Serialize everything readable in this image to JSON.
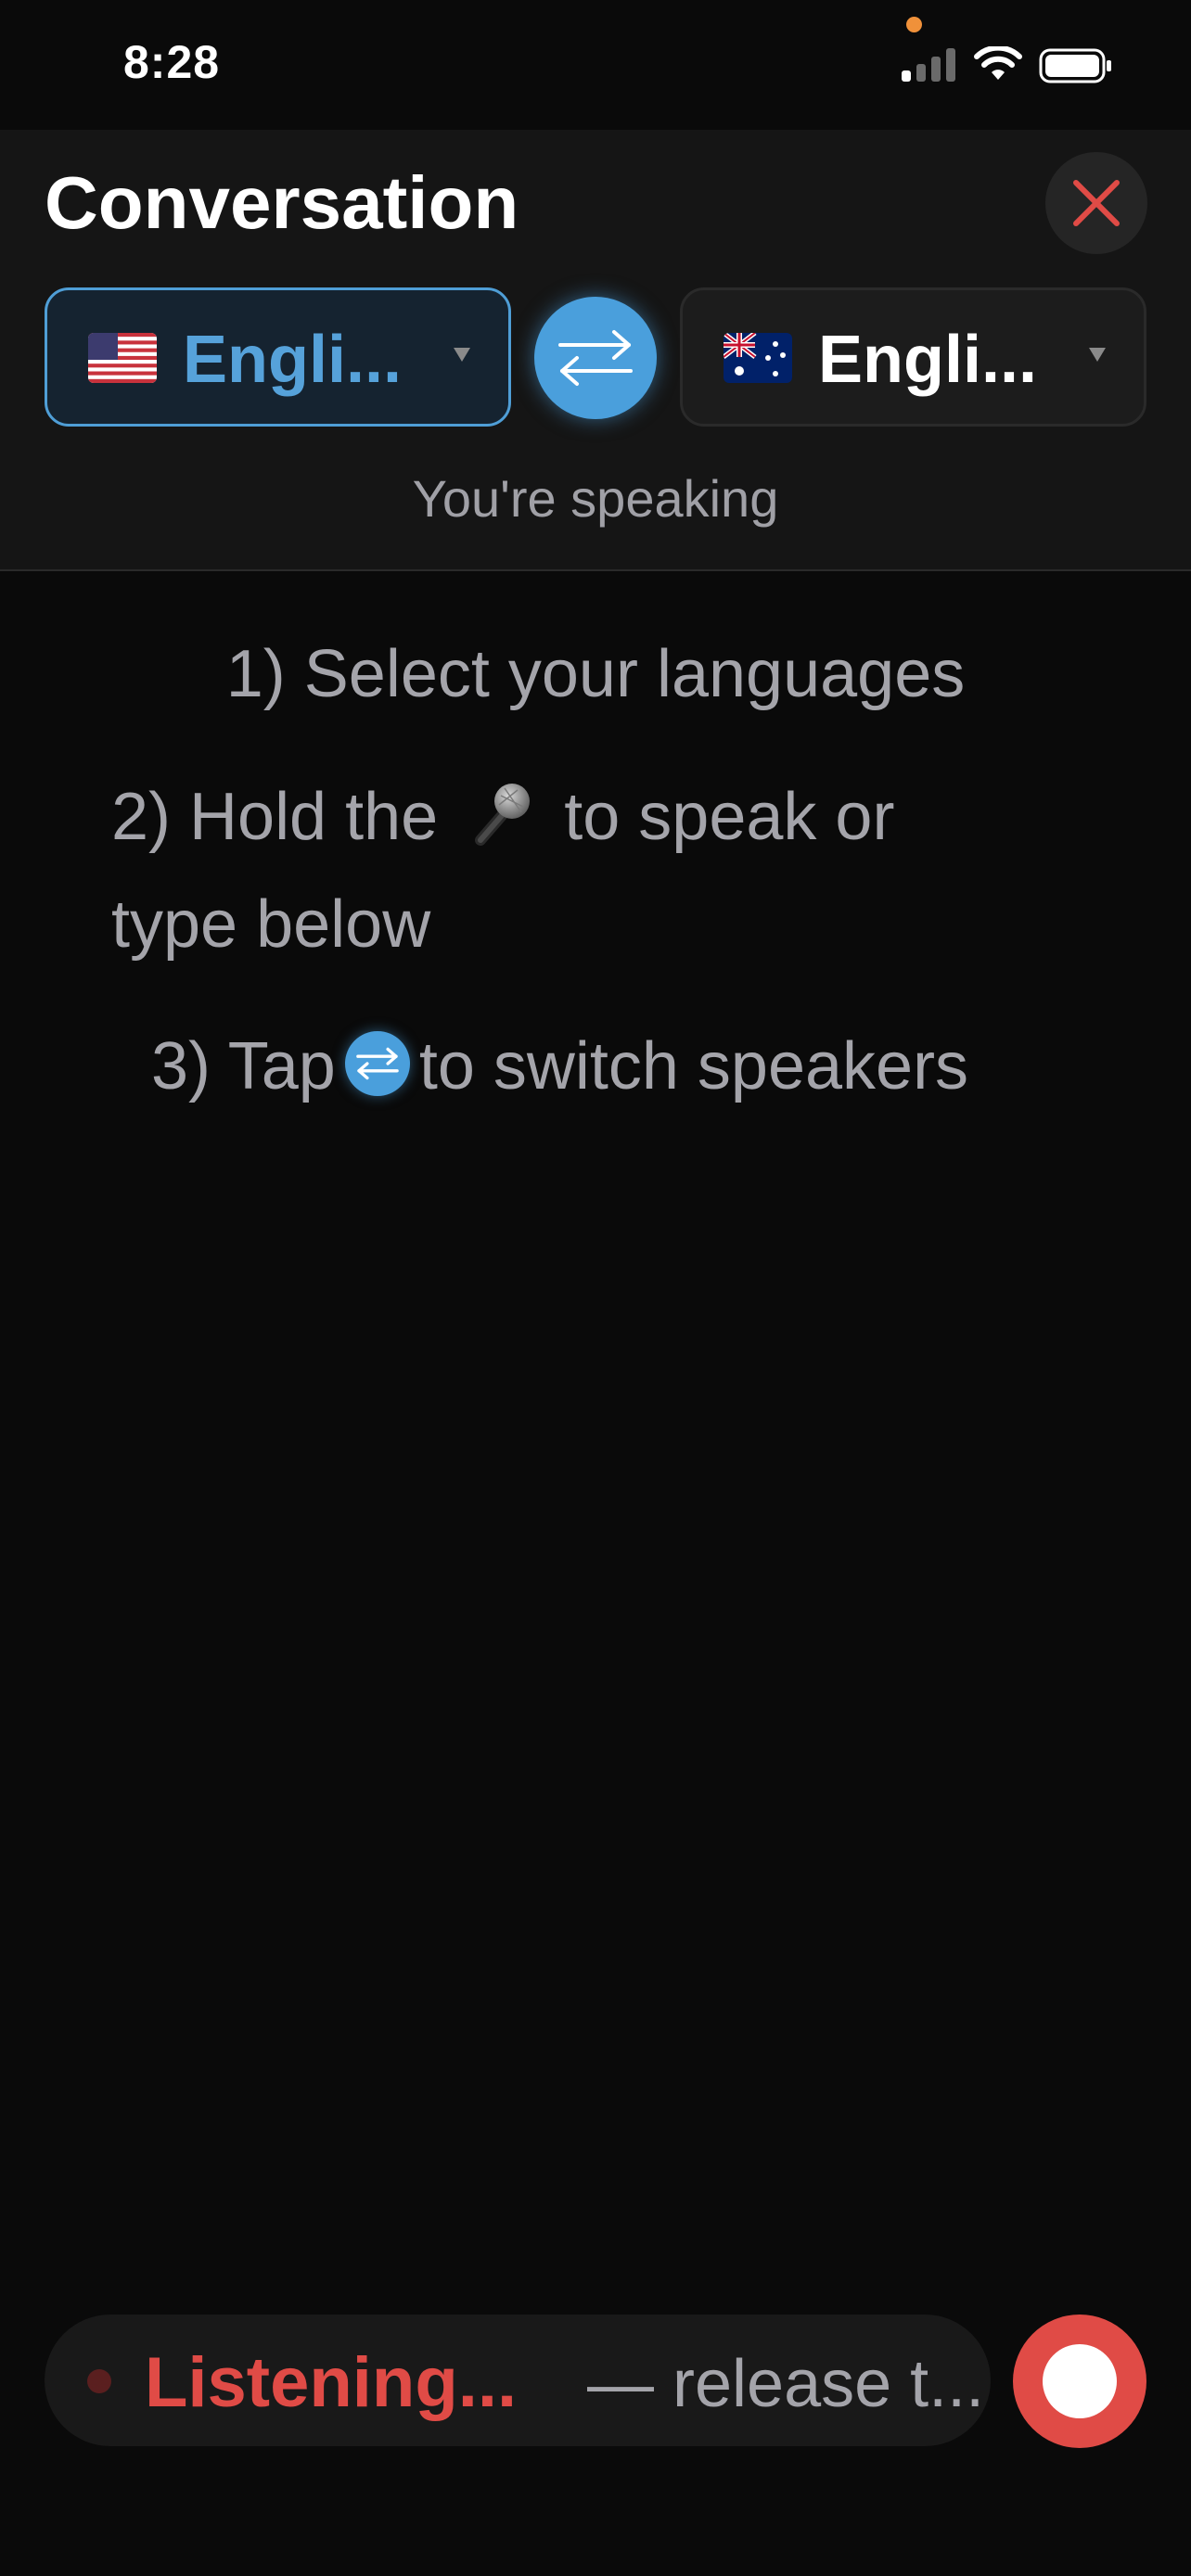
{
  "status_bar": {
    "time": "8:28",
    "icons": [
      "cellular-signal-icon",
      "wifi-icon",
      "battery-icon"
    ]
  },
  "header": {
    "title": "Conversation",
    "close_icon": "close-icon",
    "source_language": {
      "flag_icon": "us-flag-icon",
      "label": "Engli...",
      "selected": true
    },
    "target_language": {
      "flag_icon": "au-flag-icon",
      "label": "Engli..."
    },
    "swap_icon": "swap-arrows-icon",
    "speaking_status": "You're speaking"
  },
  "instructions": {
    "step1": "1) Select your languages",
    "step2_before": "2) Hold the",
    "step2_after": "to speak or",
    "step2_line2": "type below",
    "step3_before": "3) Tap",
    "step3_after": "to switch speakers"
  },
  "bottom_bar": {
    "listening_label": "Listening...",
    "release_hint": "— release t...",
    "record_icon": "record-button-icon"
  },
  "colors": {
    "accent_blue": "#4a9fdc",
    "record_red": "#e04b46",
    "background": "#0a0a0a",
    "panel": "#151515"
  }
}
